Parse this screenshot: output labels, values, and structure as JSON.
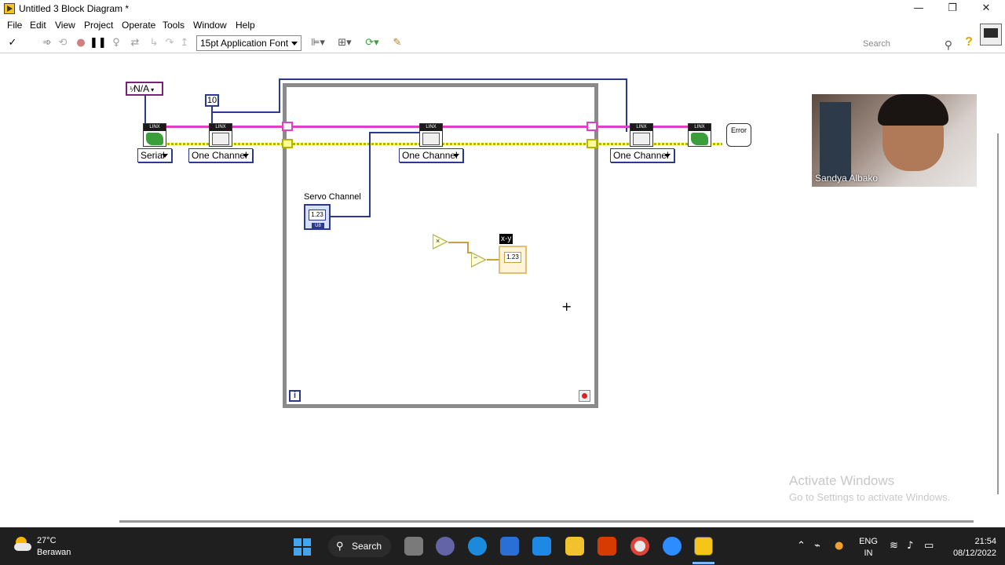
{
  "window": {
    "title": "Untitled 3 Block Diagram *",
    "minimize": "—",
    "restore": "❐",
    "close": "✕"
  },
  "menu": [
    "File",
    "Edit",
    "View",
    "Project",
    "Operate",
    "Tools",
    "Window",
    "Help"
  ],
  "toolbar": {
    "font": "15pt Application Font",
    "search_placeholder": "Search"
  },
  "diagram": {
    "na_constant": "N/A",
    "numeric_constant": "10",
    "serial_dropdown": "Serial",
    "channel_dropdown_1": "One Channel",
    "channel_dropdown_2": "One Channel",
    "channel_dropdown_3": "One Channel",
    "servo_label": "Servo Channel",
    "control_value": "1.23",
    "control_rep": "U8",
    "indicator_value": "1.23",
    "indicator_label": "x-y",
    "iteration": "i",
    "linx_header": "LINX",
    "error_text": "Error",
    "multiply_symbol": "×",
    "subtract_symbol": "−"
  },
  "webcam": {
    "name": "Sandya Albako"
  },
  "watermark": {
    "line1": "Activate Windows",
    "line2": "Go to Settings to activate Windows."
  },
  "taskbar": {
    "temp": "27°C",
    "condition": "Berawan",
    "search": "Search",
    "lang1": "ENG",
    "lang2": "IN",
    "time": "21:54",
    "date": "08/12/2022"
  },
  "colors": {
    "pink_wire": "#e040c8",
    "yellow_wire": "#b5b500",
    "blue_wire": "#2b3a8f",
    "loop_border": "#8a8a8a"
  }
}
